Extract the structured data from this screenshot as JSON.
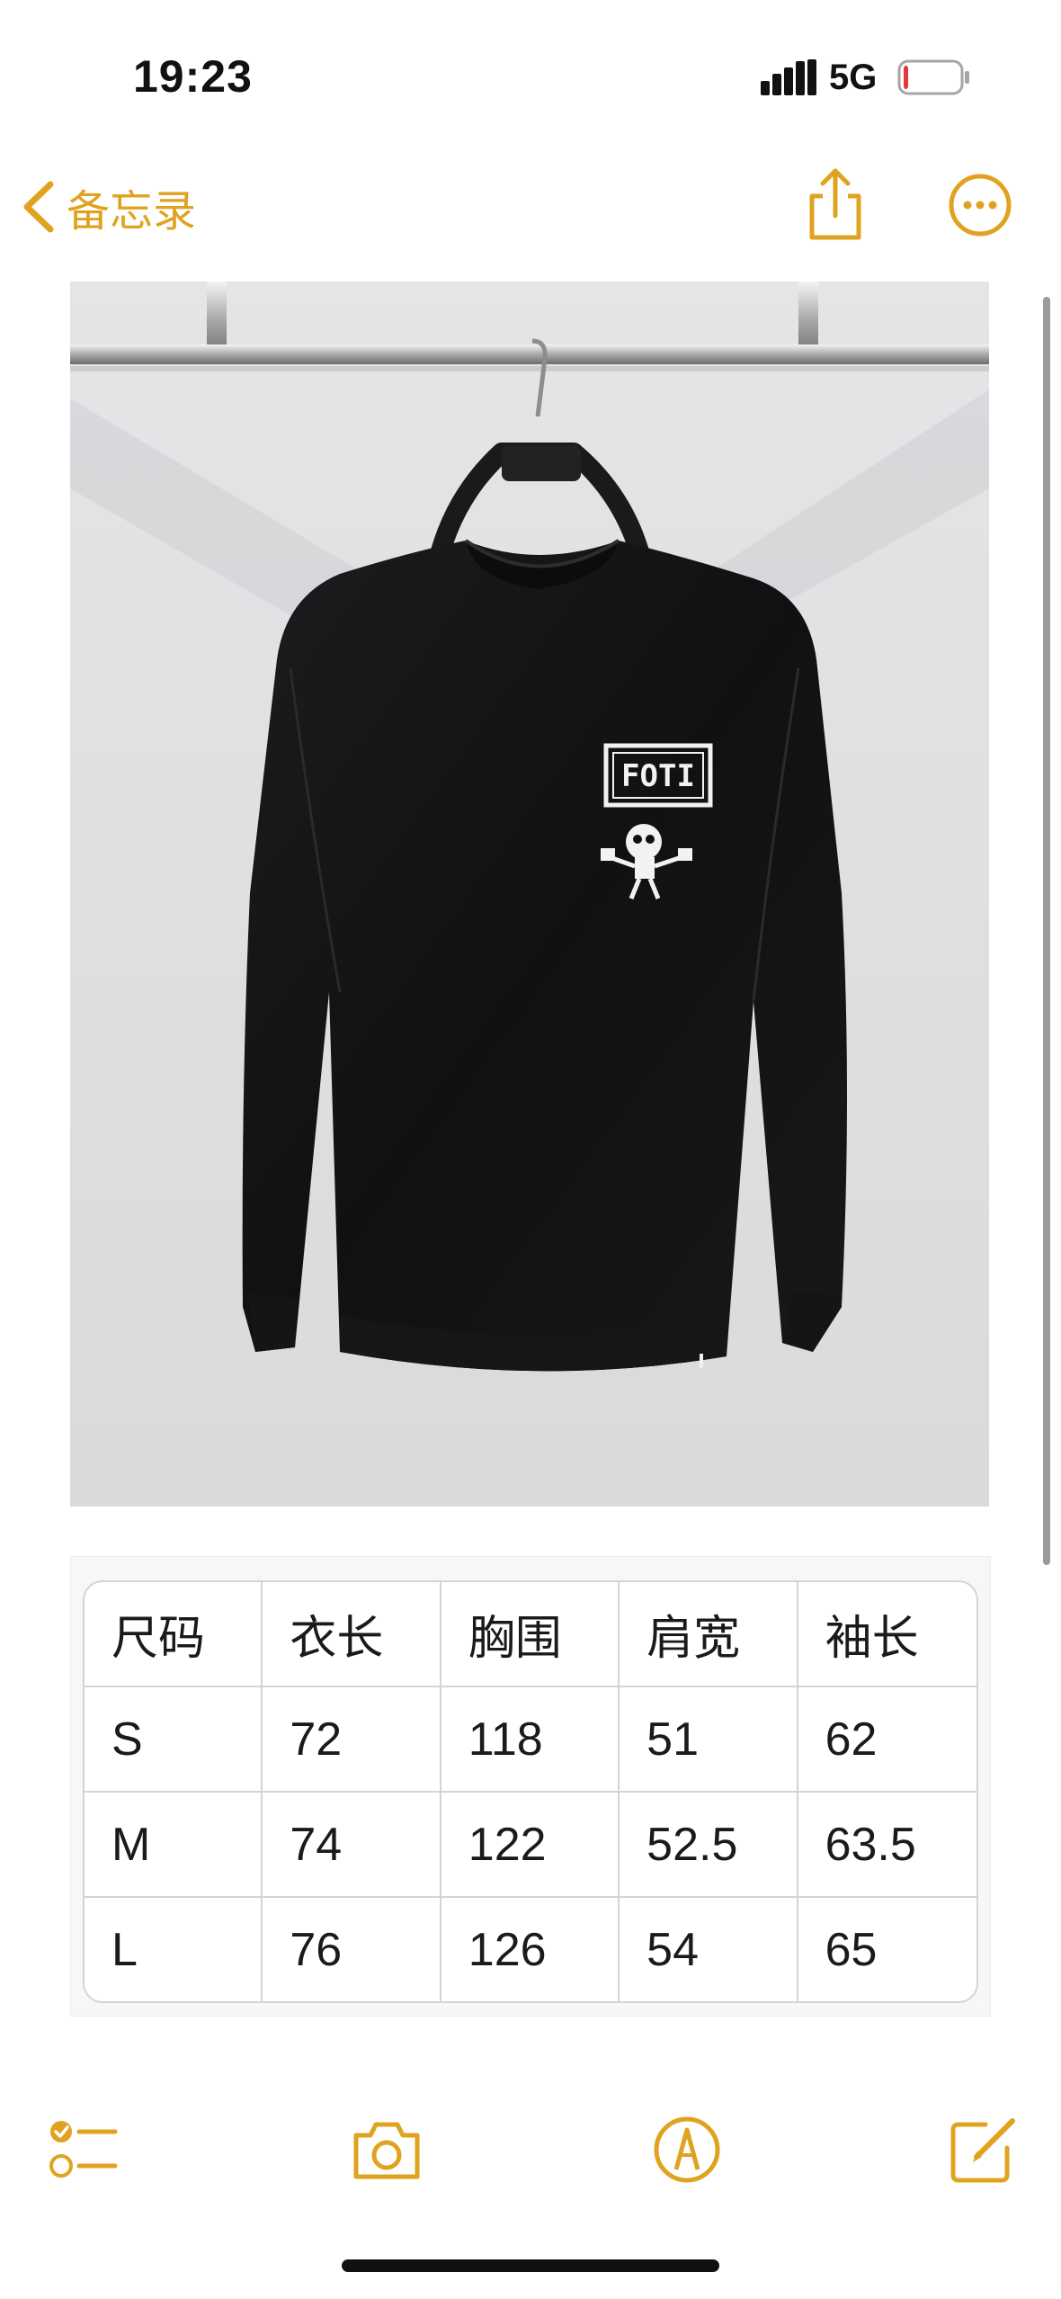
{
  "status_bar": {
    "time": "19:23",
    "network": "5G",
    "battery_level": 0.08
  },
  "nav": {
    "back_label": "备忘录",
    "share_icon": "share-icon",
    "more_icon": "more-ellipsis-icon"
  },
  "colors": {
    "accent": "#e0a320",
    "text": "#111111",
    "table_border": "#d4d4d4"
  },
  "photo": {
    "icon": "tshirt-photo",
    "print_text": "FOTI"
  },
  "size_table": {
    "header": [
      "尺码",
      "衣长",
      "胸围",
      "肩宽",
      "袖长"
    ],
    "rows": [
      [
        "S",
        "72",
        "118",
        "51",
        "62"
      ],
      [
        "M",
        "74",
        "122",
        "52.5",
        "63.5"
      ],
      [
        "L",
        "76",
        "126",
        "54",
        "65"
      ]
    ]
  },
  "toolbar": {
    "items": [
      {
        "icon": "checklist-icon"
      },
      {
        "icon": "camera-icon"
      },
      {
        "icon": "markup-pen-icon"
      },
      {
        "icon": "compose-icon"
      }
    ]
  }
}
